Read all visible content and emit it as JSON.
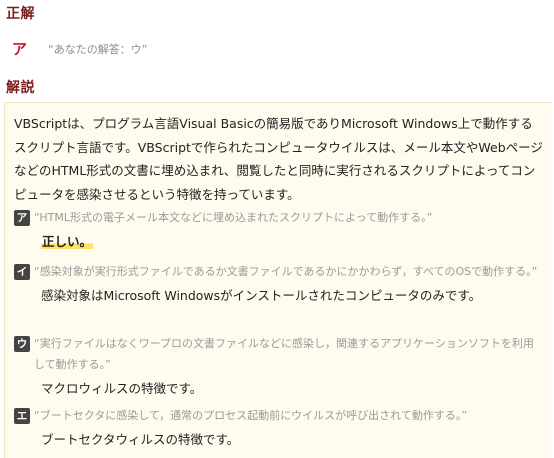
{
  "answer_section": {
    "heading": "正解",
    "answer": "ア",
    "your_answer": "“あなたの解答：ウ”"
  },
  "explanation_section": {
    "heading": "解説",
    "intro": "VBScriptは、プログラム言語Visual Basicの簡易版でありMicrosoft Windows上で動作するスクリプト言語です。VBScriptで作られたコンピュータウイルスは、メール本文やWebページなどのHTML形式の文書に埋め込まれ、閲覧したと同時に実行されるスクリプトによってコンピュータを感染させるという特徴を持っています。",
    "choices": [
      {
        "label": "ア",
        "quote": "“HTML形式の電子メール本文などに埋め込まれたスクリプトによって動作する。”",
        "comment": "正しい。"
      },
      {
        "label": "イ",
        "quote": "“感染対象が実行形式ファイルであるか文書ファイルであるかにかかわらず，すべてのOSで動作する。”",
        "comment": "感染対象はMicrosoft Windowsがインストールされたコンピュータのみです。"
      },
      {
        "label": "ウ",
        "quote": "“実行ファイルはなくワープロの文書ファイルなどに感染し，関連するアプリケーションソフトを利用して動作する。”",
        "comment": "マクロウィルスの特徴です。"
      },
      {
        "label": "エ",
        "quote": "“ブートセクタに感染して，通常のプロセス起動前にウイルスが呼び出されて動作する。”",
        "comment": "ブートセクタウィルスの特徴です。"
      }
    ]
  },
  "colors": {
    "heading": "#7a1e1e",
    "answer_letter": "#c8102e",
    "box_background": "#fffbee",
    "badge": "#444444",
    "highlight": "#ffe066"
  }
}
